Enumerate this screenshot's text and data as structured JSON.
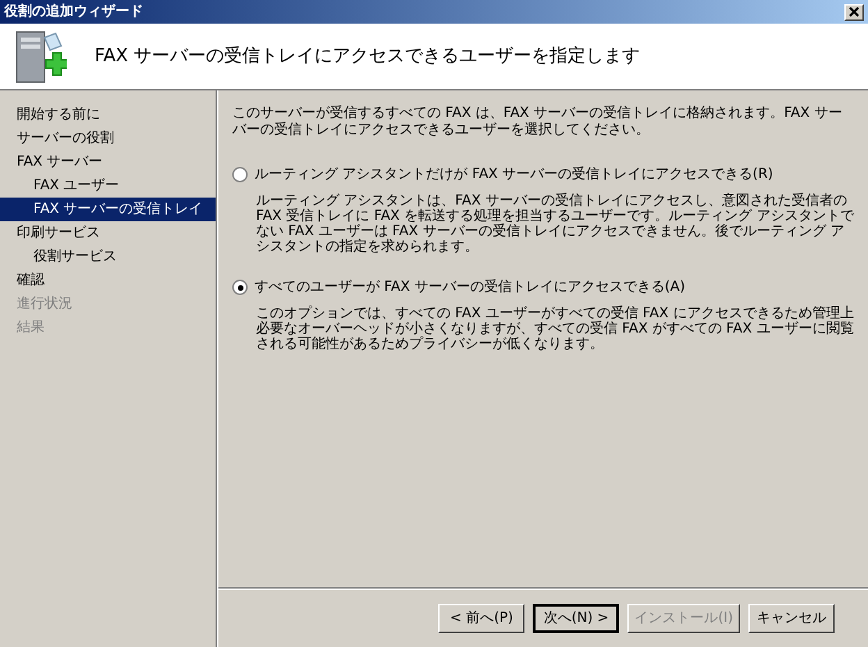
{
  "window": {
    "title": "役割の追加ウィザード"
  },
  "header": {
    "title": "FAX サーバーの受信トレイにアクセスできるユーザーを指定します"
  },
  "sidebar": {
    "items": [
      {
        "label": "開始する前に",
        "selected": false,
        "disabled": false
      },
      {
        "label": "サーバーの役割",
        "selected": false,
        "disabled": false
      },
      {
        "label": "FAX サーバー",
        "selected": false,
        "disabled": false,
        "children": [
          {
            "label": "FAX ユーザー",
            "selected": false
          },
          {
            "label": "FAX サーバーの受信トレイ",
            "selected": true
          }
        ]
      },
      {
        "label": "印刷サービス",
        "selected": false,
        "disabled": false,
        "children": [
          {
            "label": "役割サービス",
            "selected": false
          }
        ]
      },
      {
        "label": "確認",
        "selected": false,
        "disabled": false
      },
      {
        "label": "進行状況",
        "selected": false,
        "disabled": true
      },
      {
        "label": "結果",
        "selected": false,
        "disabled": true
      }
    ]
  },
  "intro": "このサーバーが受信するすべての FAX は、FAX サーバーの受信トレイに格納されます。FAX サーバーの受信トレイにアクセスできるユーザーを選択してください。",
  "options": [
    {
      "label": "ルーティング アシスタントだけが FAX サーバーの受信トレイにアクセスできる(R)",
      "selected": false,
      "description": "ルーティング アシスタントは、FAX サーバーの受信トレイにアクセスし、意図された受信者の FAX 受信トレイに FAX を転送する処理を担当するユーザーです。ルーティング アシスタントでない FAX ユーザーは FAX サーバーの受信トレイにアクセスできません。後でルーティング アシスタントの指定を求められます。"
    },
    {
      "label": "すべてのユーザーが FAX サーバーの受信トレイにアクセスできる(A)",
      "selected": true,
      "description": "このオプションでは、すべての FAX ユーザーがすべての受信 FAX にアクセスできるため管理上必要なオーバーヘッドが小さくなりますが、すべての受信 FAX がすべての FAX ユーザーに閲覧される可能性があるためプライバシーが低くなります。"
    }
  ],
  "buttons": [
    {
      "label": "< 前へ(P)",
      "disabled": false,
      "default": false
    },
    {
      "label": "次へ(N) >",
      "disabled": false,
      "default": true
    },
    {
      "label": "インストール(I)",
      "disabled": true,
      "default": false
    },
    {
      "label": "キャンセル",
      "disabled": false,
      "default": false
    }
  ]
}
